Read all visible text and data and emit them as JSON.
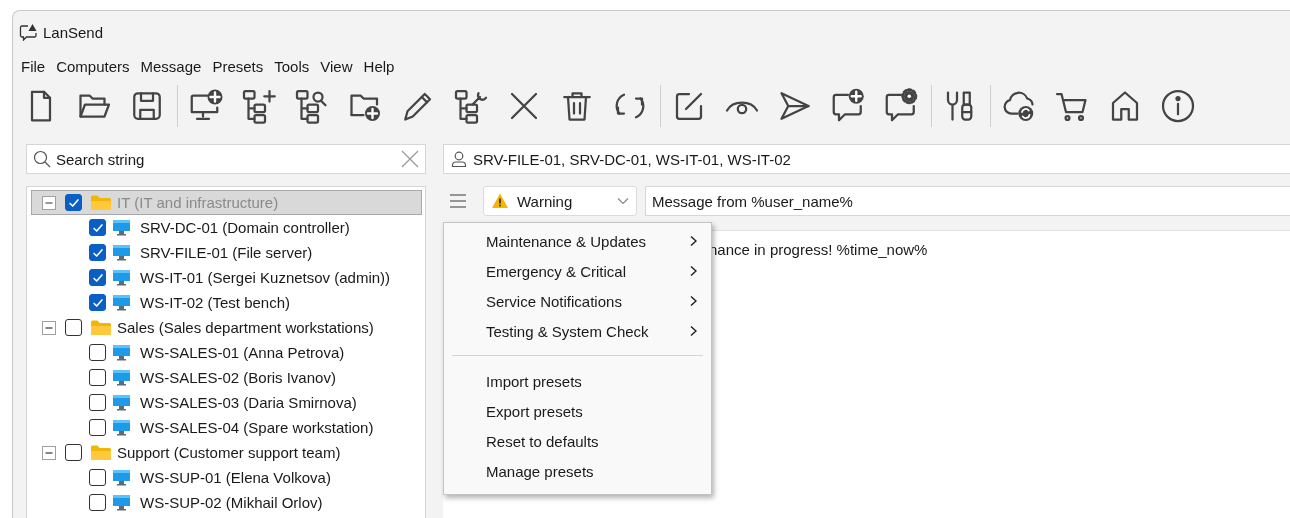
{
  "window": {
    "title": "LanSend"
  },
  "menu_bar": [
    "File",
    "Computers",
    "Message",
    "Presets",
    "Tools",
    "View",
    "Help"
  ],
  "search": {
    "placeholder": "Search string"
  },
  "recipients": {
    "value": "SRV-FILE-01, SRV-DC-01, WS-IT-01, WS-IT-02"
  },
  "tree": [
    {
      "label": "IT (IT and infrastructure)",
      "checked": true,
      "expanded": true,
      "selected": true,
      "children": [
        {
          "label": "SRV-DC-01 (Domain controller)",
          "checked": true,
          "selected": false
        },
        {
          "label": "SRV-FILE-01 (File server)",
          "checked": true,
          "selected": false
        },
        {
          "label": "WS-IT-01 (Sergei Kuznetsov (admin))",
          "checked": true,
          "selected": false
        },
        {
          "label": "WS-IT-02 (Test bench)",
          "checked": true,
          "selected": false
        }
      ]
    },
    {
      "label": "Sales (Sales department workstations)",
      "checked": false,
      "expanded": true,
      "selected": false,
      "children": [
        {
          "label": "WS-SALES-01 (Anna Petrova)",
          "checked": false,
          "selected": false
        },
        {
          "label": "WS-SALES-02 (Boris Ivanov)",
          "checked": false,
          "selected": false
        },
        {
          "label": "WS-SALES-03 (Daria Smirnova)",
          "checked": false,
          "selected": false
        },
        {
          "label": "WS-SALES-04 (Spare workstation)",
          "checked": false,
          "selected": false
        }
      ]
    },
    {
      "label": "Support (Customer support team)",
      "checked": false,
      "expanded": true,
      "selected": false,
      "children": [
        {
          "label": "WS-SUP-01 (Elena Volkova)",
          "checked": false,
          "selected": false
        },
        {
          "label": "WS-SUP-02 (Mikhail Orlov)",
          "checked": false,
          "selected": false
        }
      ]
    }
  ],
  "message": {
    "severity": {
      "value": "Warning",
      "kind": "warning"
    },
    "subject": "Message from %user_name%",
    "body": "nance in progress! %time_now%"
  },
  "presets_menu": [
    {
      "kind": "submenu",
      "label": "Maintenance & Updates"
    },
    {
      "kind": "submenu",
      "label": "Emergency & Critical"
    },
    {
      "kind": "submenu",
      "label": "Service Notifications"
    },
    {
      "kind": "submenu",
      "label": "Testing & System Check"
    },
    {
      "kind": "separator"
    },
    {
      "kind": "action",
      "label": "Import presets"
    },
    {
      "kind": "action",
      "label": "Export presets"
    },
    {
      "kind": "action",
      "label": "Reset to defaults"
    },
    {
      "kind": "action",
      "label": "Manage presets"
    }
  ]
}
